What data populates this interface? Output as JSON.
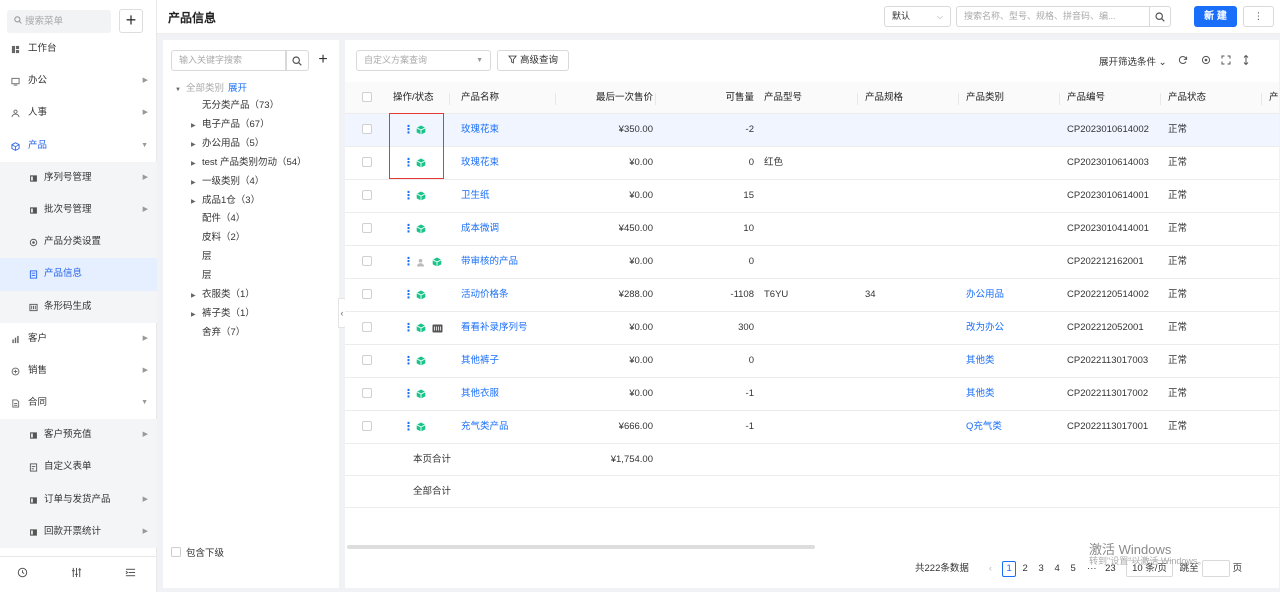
{
  "sidebar": {
    "search_placeholder": "搜索菜单",
    "add_label": "+",
    "items": [
      {
        "label": "工作台",
        "icon": "dashboard-icon",
        "level": "top",
        "arrow": false
      },
      {
        "label": "办公",
        "icon": "office-icon",
        "level": "top",
        "arrow": true
      },
      {
        "label": "人事",
        "icon": "people-icon",
        "level": "top",
        "arrow": true
      },
      {
        "label": "产品",
        "icon": "product-cube-icon",
        "level": "top",
        "arrow": true,
        "open": true
      },
      {
        "label": "序列号管理",
        "icon": "folder-icon",
        "level": "sub",
        "arrow": true
      },
      {
        "label": "批次号管理",
        "icon": "folder-icon",
        "level": "sub",
        "arrow": true
      },
      {
        "label": "产品分类设置",
        "icon": "settings-icon",
        "level": "sub",
        "arrow": false
      },
      {
        "label": "产品信息",
        "icon": "document-icon",
        "level": "sub",
        "arrow": false,
        "active": true
      },
      {
        "label": "条形码生成",
        "icon": "barcode-icon",
        "level": "sub",
        "arrow": false
      },
      {
        "label": "客户",
        "icon": "customer-icon",
        "level": "top",
        "arrow": true
      },
      {
        "label": "销售",
        "icon": "sales-icon",
        "level": "top",
        "arrow": true
      },
      {
        "label": "合同",
        "icon": "contract-icon",
        "level": "top",
        "arrow": true,
        "expanded": true
      },
      {
        "label": "客户预充值",
        "icon": "folder-icon",
        "level": "sub",
        "arrow": true
      },
      {
        "label": "自定义表单",
        "icon": "form-icon",
        "level": "sub",
        "arrow": false
      },
      {
        "label": "订单与发货产品",
        "icon": "folder-icon",
        "level": "sub",
        "arrow": true
      },
      {
        "label": "回款开票统计",
        "icon": "folder-icon",
        "level": "sub",
        "arrow": true
      }
    ],
    "bottom_icons": [
      "history-icon",
      "sliders-icon",
      "menu-collapse-icon"
    ]
  },
  "header": {
    "title": "产品信息",
    "sort_value": "默认",
    "search_placeholder": "搜索名称、型号、规格、拼音码、编...",
    "new_button": "新 建",
    "more_button": "⋮"
  },
  "category_panel": {
    "search_placeholder": "输入关键字搜索",
    "add_label": "+",
    "root_label": "全部类别",
    "expand_label": "展开",
    "nodes": [
      {
        "label": "无分类产品（73）",
        "caret": false
      },
      {
        "label": "电子产品（67）",
        "caret": true
      },
      {
        "label": "办公用品（5）",
        "caret": true
      },
      {
        "label": "test 产品类别勿动（54）",
        "caret": true
      },
      {
        "label": "一级类别（4）",
        "caret": true
      },
      {
        "label": "成品1仓（3）",
        "caret": true
      },
      {
        "label": "配件（4）",
        "caret": false
      },
      {
        "label": "皮料（2）",
        "caret": false
      },
      {
        "label": "层",
        "caret": false
      },
      {
        "label": "层",
        "caret": false
      },
      {
        "label": "衣服类（1）",
        "caret": true
      },
      {
        "label": "裤子类（1）",
        "caret": true
      },
      {
        "label": "舍弃（7）",
        "caret": false
      }
    ],
    "include_sub_label": "包含下级",
    "collapse_label": "‹"
  },
  "toolbar": {
    "scheme_placeholder": "自定义方案查询",
    "advanced_query": "高级查询",
    "expand_filters": "展开筛选条件"
  },
  "table": {
    "columns": [
      "操作/状态",
      "产品名称",
      "最后一次售价",
      "可售量",
      "产品型号",
      "产品规格",
      "产品类别",
      "产品编号",
      "产品状态",
      "产"
    ],
    "rows": [
      {
        "name": "玫瑰花束",
        "price": "¥350.00",
        "qty": "-2",
        "model": "",
        "spec": "",
        "category": "",
        "code": "CP2023010614002",
        "status": "正常",
        "extra_icons": []
      },
      {
        "name": "玫瑰花束",
        "price": "¥0.00",
        "qty": "0",
        "model": "红色",
        "spec": "",
        "category": "",
        "code": "CP2023010614003",
        "status": "正常",
        "extra_icons": []
      },
      {
        "name": "卫生纸",
        "price": "¥0.00",
        "qty": "15",
        "model": "",
        "spec": "",
        "category": "",
        "code": "CP2023010614001",
        "status": "正常",
        "extra_icons": []
      },
      {
        "name": "成本微调",
        "price": "¥450.00",
        "qty": "10",
        "model": "",
        "spec": "",
        "category": "",
        "code": "CP2023010414001",
        "status": "正常",
        "extra_icons": []
      },
      {
        "name": "带审核的产品",
        "price": "¥0.00",
        "qty": "0",
        "model": "",
        "spec": "",
        "category": "",
        "code": "CP202212162001",
        "status": "正常",
        "extra_icons": [
          "person-icon"
        ]
      },
      {
        "name": "活动价格条",
        "price": "¥288.00",
        "qty": "-1108",
        "model": "T6YU",
        "spec": "34",
        "category": "办公用品",
        "code": "CP2022120514002",
        "status": "正常",
        "extra_icons": []
      },
      {
        "name": "看看补录序列号",
        "price": "¥0.00",
        "qty": "300",
        "model": "",
        "spec": "",
        "category": "改为办公",
        "code": "CP202212052001",
        "status": "正常",
        "extra_icons": [
          "serial-number-icon"
        ]
      },
      {
        "name": "其他裤子",
        "price": "¥0.00",
        "qty": "0",
        "model": "",
        "spec": "",
        "category": "其他类",
        "code": "CP2022113017003",
        "status": "正常",
        "extra_icons": []
      },
      {
        "name": "其他衣服",
        "price": "¥0.00",
        "qty": "-1",
        "model": "",
        "spec": "",
        "category": "其他类",
        "code": "CP2022113017002",
        "status": "正常",
        "extra_icons": []
      },
      {
        "name": "充气类产品",
        "price": "¥666.00",
        "qty": "-1",
        "model": "",
        "spec": "",
        "category": "Q充气类",
        "code": "CP2022113017001",
        "status": "正常",
        "extra_icons": []
      }
    ],
    "page_total_label": "本页合计",
    "page_total_price": "¥1,754.00",
    "all_total_label": "全部合计"
  },
  "pagination": {
    "total": "共222条数据",
    "prev": "‹",
    "pages": [
      "1",
      "2",
      "3",
      "4",
      "5"
    ],
    "ellipsis": "···",
    "last_page": "23",
    "page_size": "10 条/页",
    "goto_label": "跳至",
    "page_suffix": "页"
  },
  "watermark": {
    "title": "激活 Windows",
    "subtitle": "转到\"设置\"以激活 Windows。"
  },
  "colors": {
    "primary": "#1a6ffa",
    "status_green": "#19c38a",
    "highlight": "#e53935"
  }
}
